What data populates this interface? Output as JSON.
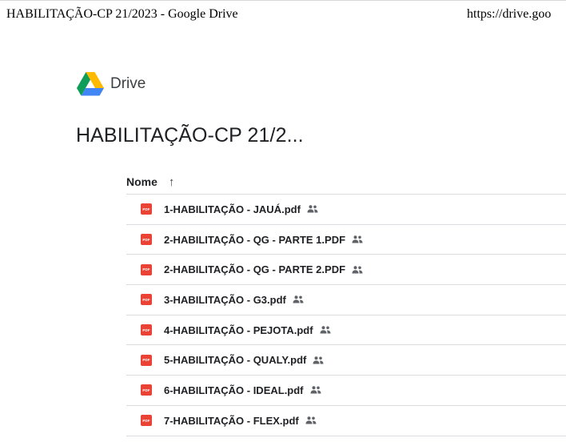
{
  "print_header": {
    "title": "HABILITAÇÃO-CP 21/2023 - Google Drive",
    "url": "https://drive.goo"
  },
  "brand": {
    "name": "Drive",
    "logo_icon": "google-drive-logo-icon"
  },
  "folder": {
    "title": "HABILITAÇÃO-CP 21/2..."
  },
  "list": {
    "column_name": "Nome",
    "sort_arrow": "↑",
    "sort_icon": "arrow-up-icon",
    "file_icon_text": "PDF",
    "files": [
      {
        "name": "1-HABILITAÇÃO - JAUÁ.pdf",
        "shared": true
      },
      {
        "name": "2-HABILITAÇÃO - QG - PARTE 1.PDF",
        "shared": true
      },
      {
        "name": "2-HABILITAÇÃO - QG - PARTE 2.PDF",
        "shared": true
      },
      {
        "name": "3-HABILITAÇÃO - G3.pdf",
        "shared": true
      },
      {
        "name": "4-HABILITAÇÃO - PEJOTA.pdf",
        "shared": true
      },
      {
        "name": "5-HABILITAÇÃO - QUALY.pdf",
        "shared": true
      },
      {
        "name": "6-HABILITAÇÃO -  IDEAL.pdf",
        "shared": true
      },
      {
        "name": "7-HABILITAÇÃO - FLEX.pdf",
        "shared": true
      }
    ]
  },
  "colors": {
    "pdf_red": "#ea4335",
    "divider": "#dadce0",
    "text": "#202124"
  }
}
